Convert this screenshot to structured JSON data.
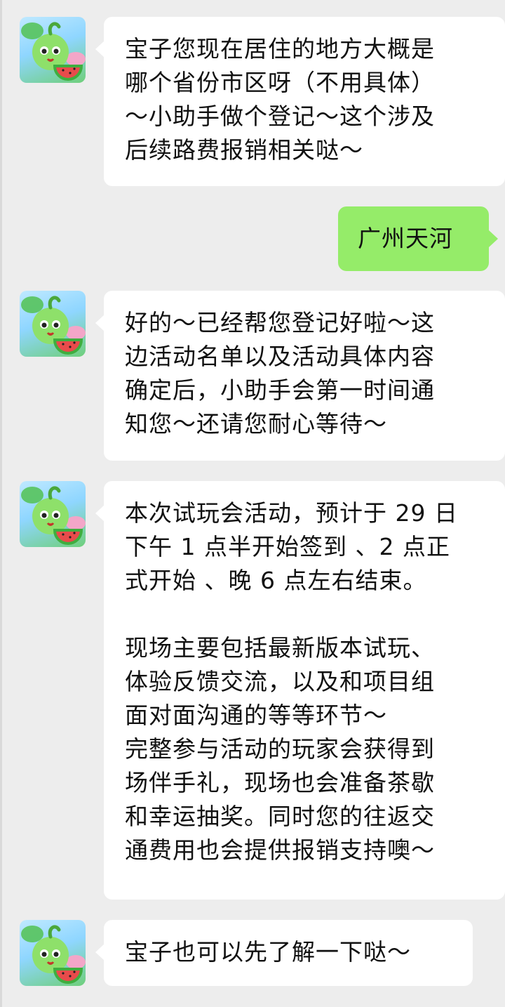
{
  "conversation": {
    "messages": [
      {
        "sender": "assistant",
        "text": "宝子您现在居住的地方大概是\n哪个省份市区呀（不用具体）\n～小助手做个登记～这个涉及\n后续路费报销相关哒～"
      },
      {
        "sender": "user",
        "text": "广州天河"
      },
      {
        "sender": "assistant",
        "text": "好的～已经帮您登记好啦～这\n边活动名单以及活动具体内容\n确定后，小助手会第一时间通\n知您～还请您耐心等待～"
      },
      {
        "sender": "assistant",
        "text": "本次试玩会活动，预计于 29 日\n下午 1 点半开始签到 、2 点正\n式开始 、晚 6 点左右结束。\n\n现场主要包括最新版本试玩、\n体验反馈交流，以及和项目组\n面对面沟通的等等环节～\n完整参与活动的玩家会获得到\n场伴手礼，现场也会准备茶歇\n和幸运抽奖。同时您的往返交\n通费用也会提供报销支持噢～"
      },
      {
        "sender": "assistant",
        "text": "宝子也可以先了解一下哒～"
      }
    ]
  },
  "theme": {
    "chat_background": "#ededed",
    "incoming_bubble": "#ffffff",
    "outgoing_bubble": "#95ec69"
  },
  "avatar_icon": "green-sprout-mascot-with-watermelon"
}
